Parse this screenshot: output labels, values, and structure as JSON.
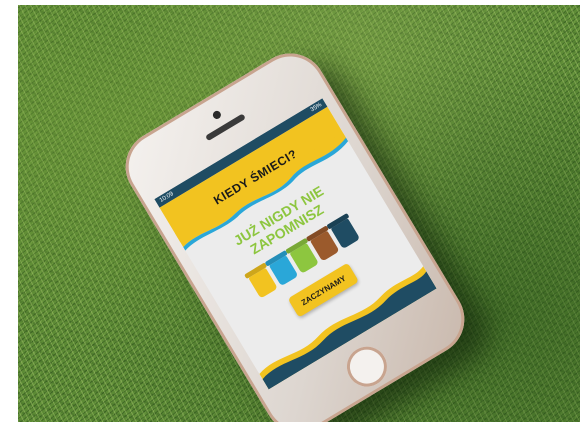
{
  "app": {
    "title": "KIEDY ŚMIECI?",
    "tagline_line1": "JUŻ NIGDY NIE",
    "tagline_line2": "ZAPOMNISZ",
    "start_button": "ZACZYNAMY"
  },
  "status_bar": {
    "time": "10:09",
    "battery": "35%"
  },
  "colors": {
    "brand_yellow": "#f2c320",
    "brand_navy": "#1f4c63",
    "brand_green": "#8dc63f",
    "bin_blue": "#2aa7d8",
    "bin_brown": "#9b5a2c",
    "grass": "#5c8a35"
  },
  "icons": [
    "yellow-bin-icon",
    "blue-bin-icon",
    "green-bin-icon",
    "brown-bin-icon",
    "navy-bin-icon"
  ]
}
